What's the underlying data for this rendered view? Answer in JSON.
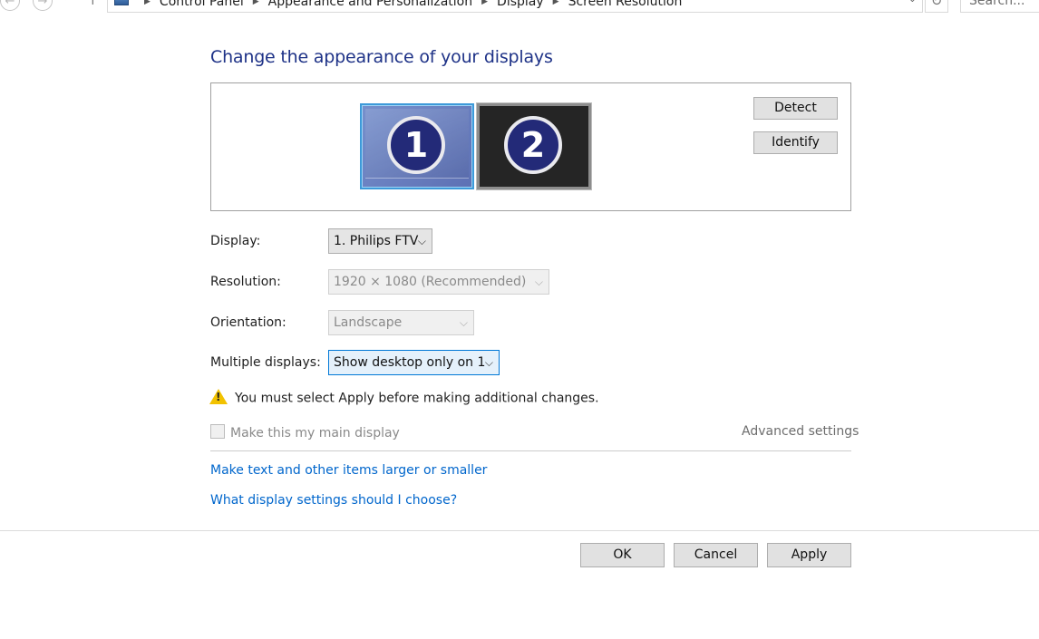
{
  "address_bar": {
    "crumbs": [
      "Control Panel",
      "Appearance and Personalization",
      "Display",
      "Screen Resolution"
    ],
    "search_placeholder": "Search..."
  },
  "page_title": "Change the appearance of your displays",
  "monitors": [
    {
      "number": "1",
      "selected": true
    },
    {
      "number": "2",
      "selected": false
    }
  ],
  "buttons": {
    "detect": "Detect",
    "identify": "Identify",
    "ok": "OK",
    "cancel": "Cancel",
    "apply": "Apply"
  },
  "settings": {
    "display_label": "Display:",
    "display_value": "1. Philips FTV",
    "resolution_label": "Resolution:",
    "resolution_value": "1920 × 1080 (Recommended)",
    "orientation_label": "Orientation:",
    "orientation_value": "Landscape",
    "multiple_label": "Multiple displays:",
    "multiple_value": "Show desktop only on 1"
  },
  "warning": "You must select Apply before making additional changes.",
  "main_display_checkbox": {
    "label": "Make this my main display",
    "checked": false
  },
  "advanced_settings": "Advanced settings",
  "links": {
    "text_size": "Make text and other items larger or smaller",
    "which_settings": "What display settings should I choose?"
  },
  "colors": {
    "title": "#1e3287",
    "link": "#0066cc",
    "selected_border": "#3d9ad9"
  }
}
